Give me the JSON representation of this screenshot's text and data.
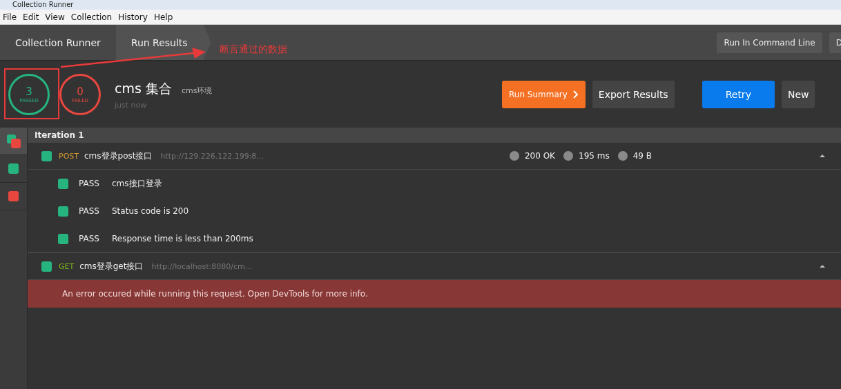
{
  "window": {
    "title": "Collection Runner"
  },
  "menu": [
    "File",
    "Edit",
    "View",
    "Collection",
    "History",
    "Help"
  ],
  "breadcrumbs": [
    {
      "label": "Collection Runner",
      "selected": false
    },
    {
      "label": "Run Results",
      "selected": true
    }
  ],
  "header_buttons": [
    "Run In Command Line",
    "D"
  ],
  "summary": {
    "passed": {
      "count": "3",
      "label": "PASSED"
    },
    "failed": {
      "count": "0",
      "label": "FAILED"
    },
    "collection": "cms 集合",
    "environment": "cms环境",
    "time": "just now"
  },
  "actions": [
    {
      "label": "Run Summary",
      "kind": "summary"
    },
    {
      "label": "Export Results",
      "kind": "plain"
    },
    {
      "label": "Retry",
      "kind": "primary"
    },
    {
      "label": "New",
      "kind": "plain"
    }
  ],
  "annotation": {
    "text": "断言通过的数据"
  },
  "sidebar": [
    {
      "kind": "mixed",
      "selected": true
    },
    {
      "kind": "pass",
      "selected": false
    },
    {
      "kind": "fail",
      "selected": false
    }
  ],
  "iteration": "Iteration 1",
  "requests": [
    {
      "method": "POST",
      "name": "cms登录post接口",
      "url": "http://129.226.122.199:8...",
      "stats": [
        "200 OK",
        "195 ms",
        "49 B"
      ],
      "expanded": true,
      "tests": [
        {
          "status": "PASS",
          "name": "cms接口登录"
        },
        {
          "status": "PASS",
          "name": "Status code is 200"
        },
        {
          "status": "PASS",
          "name": "Response time is less than 200ms"
        }
      ]
    },
    {
      "method": "GET",
      "name": "cms登录get接口",
      "url": "http://localhost:8080/cm...",
      "expanded": true,
      "error": "An error occured while running this request. Open DevTools for more info."
    }
  ]
}
